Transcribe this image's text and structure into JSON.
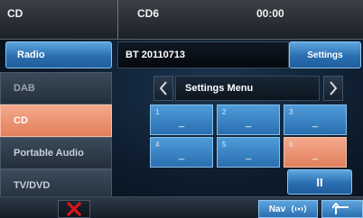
{
  "header": {
    "left_title": "CD",
    "disc_label": "CD6",
    "time": "00:00"
  },
  "row2": {
    "radio_label": "Radio",
    "track_name": "BT 20110713",
    "settings_label": "Settings"
  },
  "settings_nav": {
    "title": "Settings Menu"
  },
  "sidebar": {
    "items": [
      {
        "label": "DAB"
      },
      {
        "label": "CD"
      },
      {
        "label": "Portable Audio"
      },
      {
        "label": "TV/DVD"
      }
    ]
  },
  "presets": [
    {
      "number": "1",
      "value": "_"
    },
    {
      "number": "2",
      "value": "_"
    },
    {
      "number": "3",
      "value": "_"
    },
    {
      "number": "4",
      "value": "_"
    },
    {
      "number": "5",
      "value": "_"
    },
    {
      "number": "6",
      "value": "_"
    }
  ],
  "transport": {
    "pause_symbol": "II"
  },
  "bottom": {
    "nav_label": "Nav"
  },
  "colors": {
    "accent": "#e2805d",
    "primary_blue": "#2a6eb0",
    "close_red": "#d8151b"
  }
}
